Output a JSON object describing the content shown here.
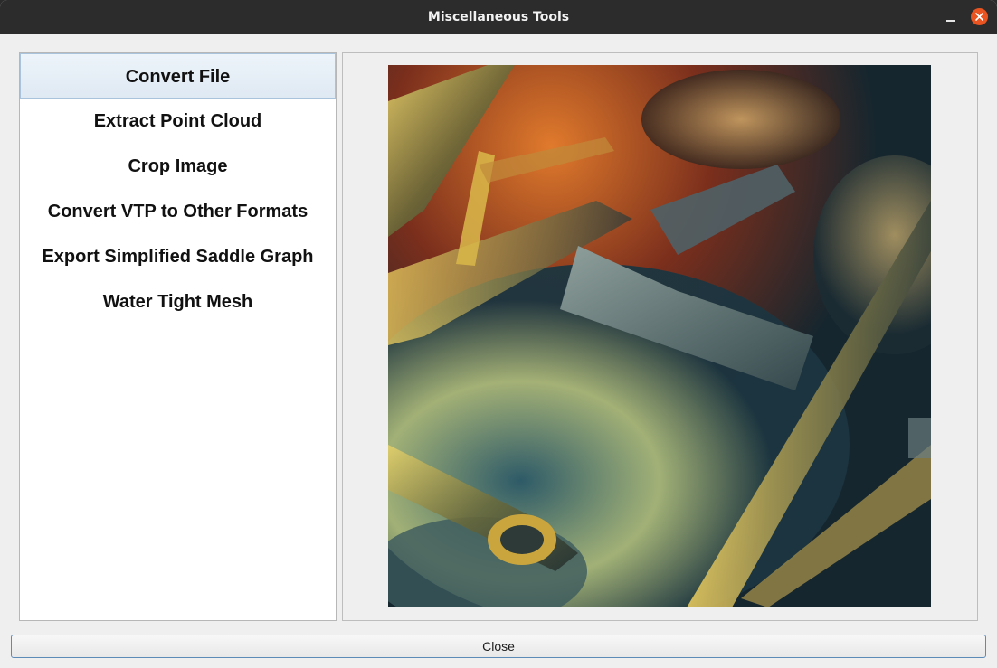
{
  "window": {
    "title": "Miscellaneous Tools"
  },
  "tools": {
    "items": [
      {
        "label": "Convert File",
        "selected": true
      },
      {
        "label": "Extract Point Cloud",
        "selected": false
      },
      {
        "label": "Crop Image",
        "selected": false
      },
      {
        "label": "Convert VTP to Other Formats",
        "selected": false
      },
      {
        "label": "Export Simplified Saddle Graph",
        "selected": false
      },
      {
        "label": "Water Tight Mesh",
        "selected": false
      }
    ]
  },
  "footer": {
    "close_label": "Close"
  },
  "colors": {
    "titlebar": "#2c2c2c",
    "close_accent": "#e95420",
    "selection": "#dfe9f3",
    "button_border": "#5d8bb7"
  },
  "icons": {
    "minimize": "minimize-icon",
    "close": "close-icon"
  }
}
